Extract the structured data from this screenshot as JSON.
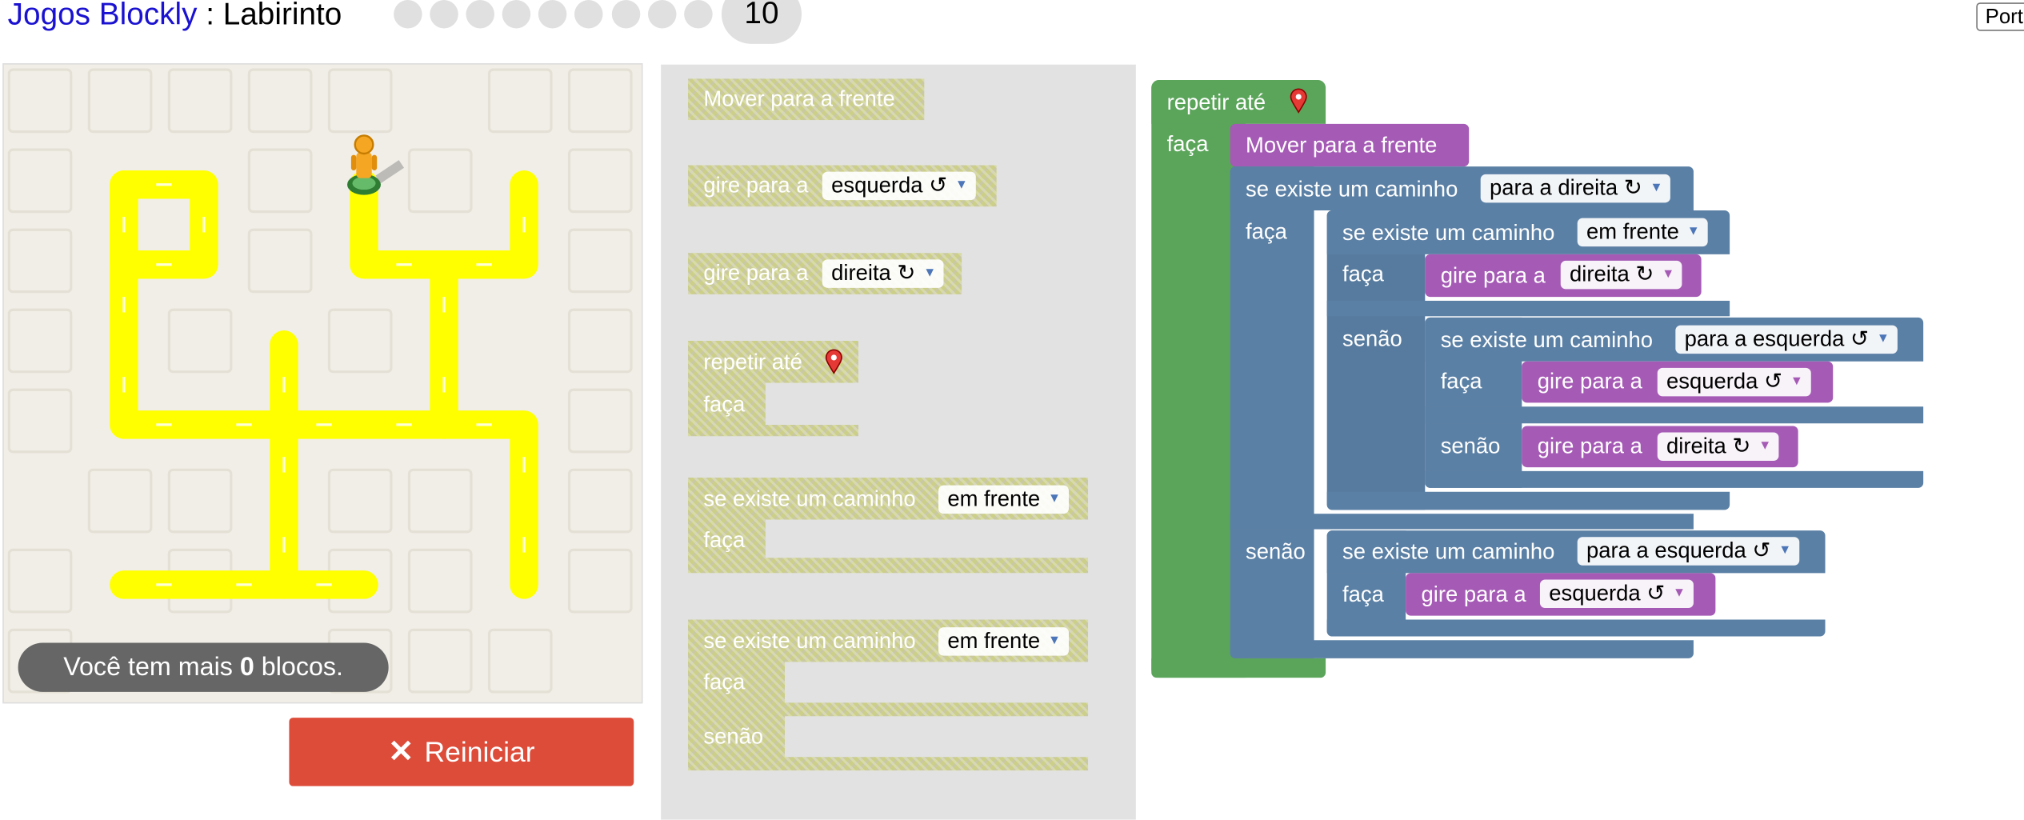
{
  "header": {
    "app_link": "Jogos Blockly",
    "separator": " : ",
    "game_name": "Labirinto",
    "current_level": "10",
    "language_button": "Português"
  },
  "maze": {
    "capacity_prefix": "Você tem mais ",
    "capacity_count": "0",
    "capacity_suffix": " blocos.",
    "reset_label": "Reiniciar",
    "colors": {
      "path": "#ffff00",
      "background": "#f1eee7",
      "reset": "#dd4b39"
    }
  },
  "toolbox": {
    "move_forward": "Mover para a frente",
    "turn_prefix": "gire para a",
    "turn_left": "esquerda ↺",
    "turn_right": "direita ↻",
    "repeat_until": "repetir até",
    "do_label": "faça",
    "else_label": "senão",
    "if_path": "se existe um caminho",
    "dir_ahead": "em frente"
  },
  "workspace": {
    "repeat_until": "repetir até",
    "do_label": "faça",
    "move_forward": "Mover para a frente",
    "if_path": "se existe um caminho",
    "else_label": "senão",
    "turn_prefix": "gire para a",
    "dir_right": "para a direita ↻",
    "dir_ahead": "em frente",
    "dir_left": "para a esquerda ↺",
    "turn_right": "direita ↻",
    "turn_left": "esquerda ↺",
    "colors": {
      "loop": "#5ba55b",
      "logic": "#5b80a5",
      "action": "#a55ab5"
    }
  }
}
